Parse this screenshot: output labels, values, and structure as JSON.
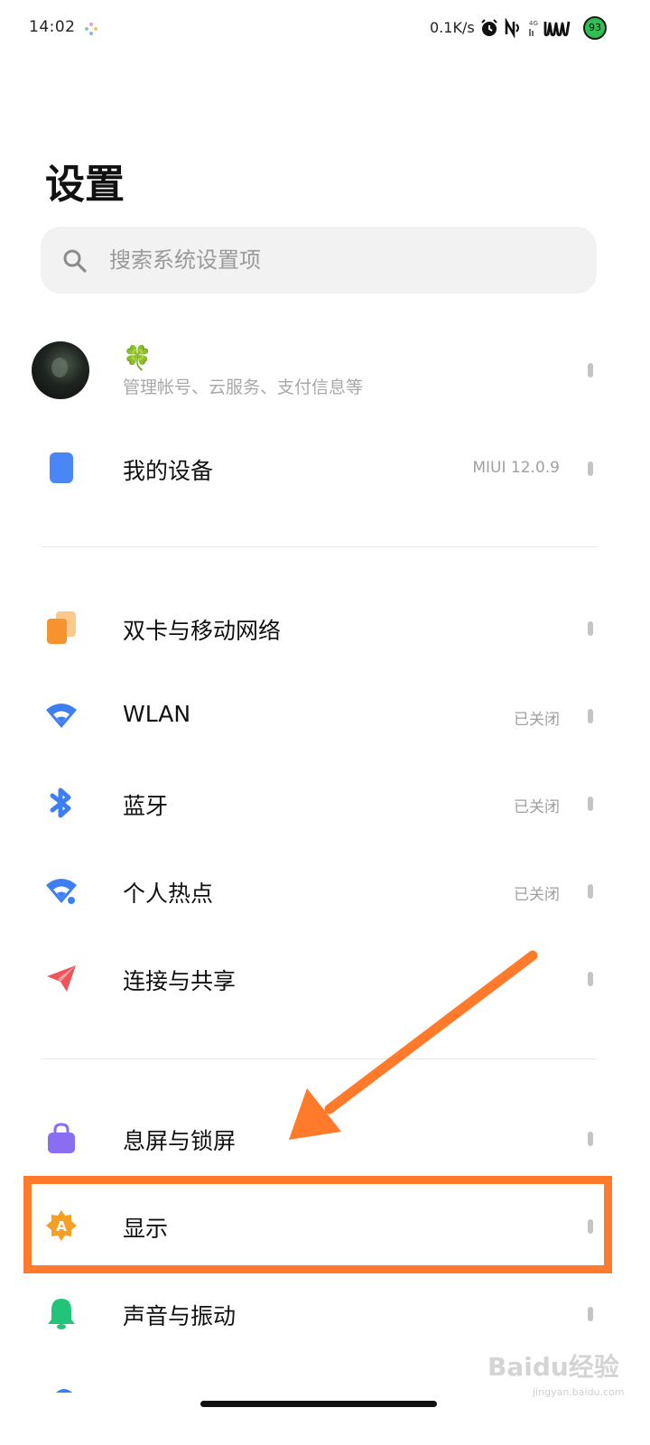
{
  "status_bar": {
    "time": "14:02",
    "net_speed": "0.1K/s",
    "battery": "93",
    "icons": [
      "alarm-icon",
      "nfc-icon",
      "signal-4g-icon",
      "wifi-hotspot-icon",
      "battery-icon"
    ]
  },
  "page_title": "设置",
  "search": {
    "placeholder": "搜索系统设置项"
  },
  "account": {
    "name_emoji": "🍀",
    "subtitle": "管理帐号、云服务、支付信息等"
  },
  "items": [
    {
      "label": "我的设备",
      "value": "MIUI 12.0.9",
      "icon": "device-icon",
      "color": "#4a86f5"
    },
    {
      "label": "双卡与移动网络",
      "value": "",
      "icon": "sim-cards-icon",
      "color": "#f79a3c"
    },
    {
      "label": "WLAN",
      "value": "已关闭",
      "icon": "wifi-icon",
      "color": "#3d7ff2"
    },
    {
      "label": "蓝牙",
      "value": "已关闭",
      "icon": "bluetooth-icon",
      "color": "#3d7ff2"
    },
    {
      "label": "个人热点",
      "value": "已关闭",
      "icon": "hotspot-icon",
      "color": "#3d7ff2"
    },
    {
      "label": "连接与共享",
      "value": "",
      "icon": "paper-plane-icon",
      "color": "#f0535a"
    },
    {
      "label": "息屏与锁屏",
      "value": "",
      "icon": "lock-bag-icon",
      "color": "#8a6ef2"
    },
    {
      "label": "显示",
      "value": "",
      "icon": "display-brightness-icon",
      "color": "#f5a024"
    },
    {
      "label": "声音与振动",
      "value": "",
      "icon": "bell-icon",
      "color": "#22c47a"
    }
  ],
  "annotation": {
    "color": "#ff7a2b"
  },
  "watermark": {
    "text": "Baidu经验",
    "sub": "jingyan.baidu.com"
  }
}
